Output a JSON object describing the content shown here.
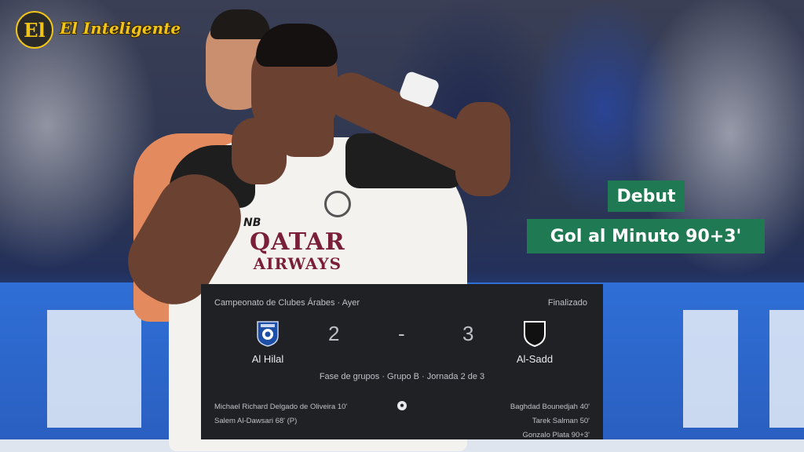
{
  "brand": {
    "logo_text": "El",
    "name": "El Inteligente"
  },
  "captions": {
    "debut": "Debut",
    "goal": "Gol al Minuto 90+3'"
  },
  "shirt": {
    "sponsor_line1": "QATAR",
    "sponsor_line2": "AIRWAYS",
    "kit_brand": "NB"
  },
  "match": {
    "competition": "Campeonato de Clubes Árabes · Ayer",
    "status": "Finalizado",
    "home": {
      "name": "Al Hilal",
      "score": "2",
      "crest": "al-hilal-crest-icon"
    },
    "separator": "-",
    "away": {
      "name": "Al-Sadd",
      "score": "3",
      "crest": "al-sadd-crest-icon"
    },
    "stage": "Fase de grupos · Grupo B · Jornada 2 de 3",
    "home_scorers": [
      "Michael Richard Delgado de Oliveira 10'",
      "Salem Al-Dawsari 68' (P)"
    ],
    "away_scorers": [
      "Baghdad Bounedjah 40'",
      "Tarek Salman 50'",
      "Gonzalo Plata 90+3'"
    ]
  },
  "colors": {
    "caption_bg": "#1f7a53",
    "card_bg": "#202124",
    "brand_gold": "#f0c419"
  }
}
